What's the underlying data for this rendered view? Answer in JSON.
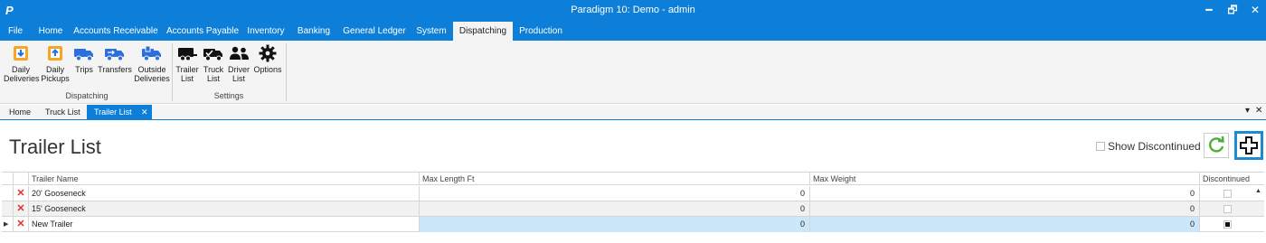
{
  "window": {
    "logo": "P",
    "title": "Paradigm 10: Demo - admin",
    "minimize_glyph": "━",
    "restore_glyph": "🗗",
    "close_glyph": "✕"
  },
  "menu": {
    "items": [
      "File",
      "Home",
      "Accounts Receivable",
      "Accounts Payable",
      "Inventory",
      "Banking",
      "General Ledger",
      "System",
      "Dispatching",
      "Production"
    ],
    "active": "Dispatching"
  },
  "ribbon": {
    "dispatching_group": {
      "label": "Dispatching",
      "buttons": [
        {
          "line1": "Daily",
          "line2": "Deliveries",
          "icon": "daily-deliveries-icon"
        },
        {
          "line1": "Daily",
          "line2": "Pickups",
          "icon": "daily-pickups-icon"
        },
        {
          "line1": "Trips",
          "line2": "",
          "icon": "truck-icon"
        },
        {
          "line1": "Transfers",
          "line2": "",
          "icon": "transfer-truck-icon"
        },
        {
          "line1": "Outside",
          "line2": "Deliveries",
          "icon": "outside-deliveries-icon"
        }
      ]
    },
    "settings_group": {
      "label": "Settings",
      "buttons": [
        {
          "line1": "Trailer",
          "line2": "List",
          "icon": "trailer-icon"
        },
        {
          "line1": "Truck",
          "line2": "List",
          "icon": "truck-list-icon"
        },
        {
          "line1": "Driver",
          "line2": "List",
          "icon": "drivers-icon"
        },
        {
          "line1": "Options",
          "line2": "",
          "icon": "gear-icon"
        }
      ]
    }
  },
  "tabs": {
    "items": [
      "Home",
      "Truck List",
      "Trailer List"
    ],
    "active": "Trailer List",
    "close_glyph": "✕",
    "dropdown_glyph": "▾",
    "close_all_glyph": "✕"
  },
  "page": {
    "title": "Trailer List",
    "show_discontinued_label": "Show Discontinued",
    "show_discontinued_checked": false,
    "refresh_icon": "refresh-icon",
    "add_icon": "add-icon"
  },
  "grid": {
    "columns": [
      "Trailer Name",
      "Max Length Ft",
      "Max Weight",
      "Discontinued"
    ],
    "delete_glyph": "✕",
    "current_row_glyph": "▶",
    "scroll_up_glyph": "▲",
    "rows": [
      {
        "name": "20' Gooseneck",
        "max_length": "0",
        "max_weight": "0",
        "discontinued": false
      },
      {
        "name": "15' Gooseneck",
        "max_length": "0",
        "max_weight": "0",
        "discontinued": false
      },
      {
        "name": "New Trailer",
        "max_length": "0",
        "max_weight": "0",
        "discontinued": true
      }
    ]
  },
  "colors": {
    "accent": "#0e7fd8",
    "delete": "#e0302a",
    "refresh": "#4caf3a",
    "selected_cell": "#cce7fa"
  }
}
